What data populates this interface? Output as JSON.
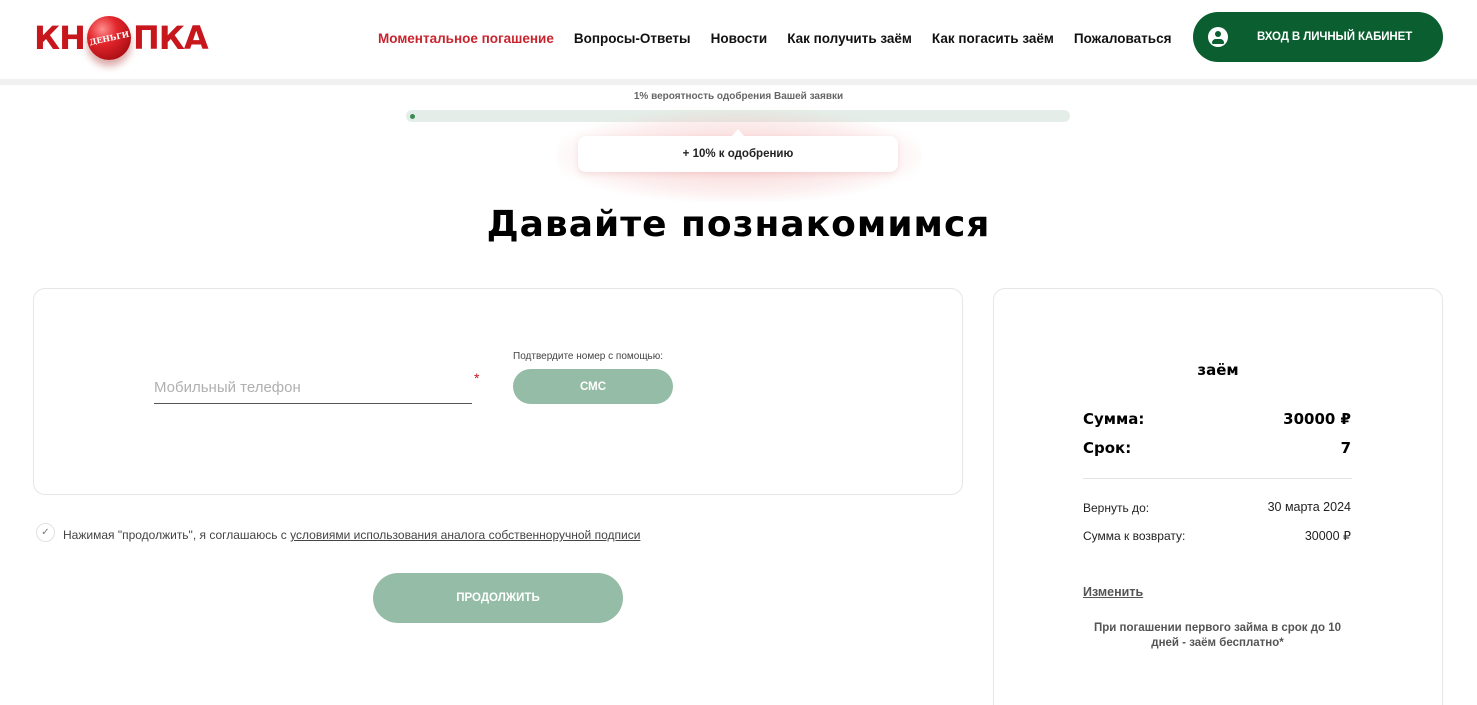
{
  "header": {
    "logo": {
      "left": "КН",
      "ball": "ДЕНЬГИ",
      "right": "ПКА"
    },
    "nav": [
      {
        "label": "Моментальное погашение",
        "active": true
      },
      {
        "label": "Вопросы-Ответы",
        "active": false
      },
      {
        "label": "Новости",
        "active": false
      },
      {
        "label": "Как получить заём",
        "active": false
      },
      {
        "label": "Как погасить заём",
        "active": false
      },
      {
        "label": "Пожаловаться",
        "active": false
      }
    ],
    "login_label": "ВХОД В ЛИЧНЫЙ КАБИНЕТ",
    "login_icon": "user-circle-icon"
  },
  "approval": {
    "probability_text": "1% вероятность одобрения Вашей заявки",
    "probability_percent": 1,
    "bonus_text": "+ 10% к одобрению"
  },
  "main": {
    "title": "Давайте познакомимся"
  },
  "form": {
    "phone_placeholder": "Мобильный телефон",
    "phone_value": "",
    "required_mark": "*",
    "confirm_label": "Подтвердите номер с помощью:",
    "sms_label": "СМС",
    "agree_prefix": "Нажимая \"продолжить\", я соглашаюсь с ",
    "agree_link": "условиями использования аналога собственноручной подписи",
    "agree_checked": true,
    "continue_label": "ПРОДОЛЖИТЬ"
  },
  "loan": {
    "title": "заём",
    "sum_label": "Сумма:",
    "sum_value": "30000 ₽",
    "term_label": "Срок:",
    "term_value": "7",
    "return_date_label": "Вернуть до:",
    "return_date_value": "30 марта 2024",
    "return_sum_label": "Сумма к возврату:",
    "return_sum_value": "30000 ₽",
    "change_label": "Изменить",
    "promo_text": "При погашении первого займа в срок до 10 дней - заём бесплатно*"
  },
  "colors": {
    "brand_red": "#c8161d",
    "brand_green": "#0a5e2f",
    "button_muted_green": "#95bca6",
    "progress_track": "#e4ede7",
    "progress_fill": "#3d8a55"
  }
}
